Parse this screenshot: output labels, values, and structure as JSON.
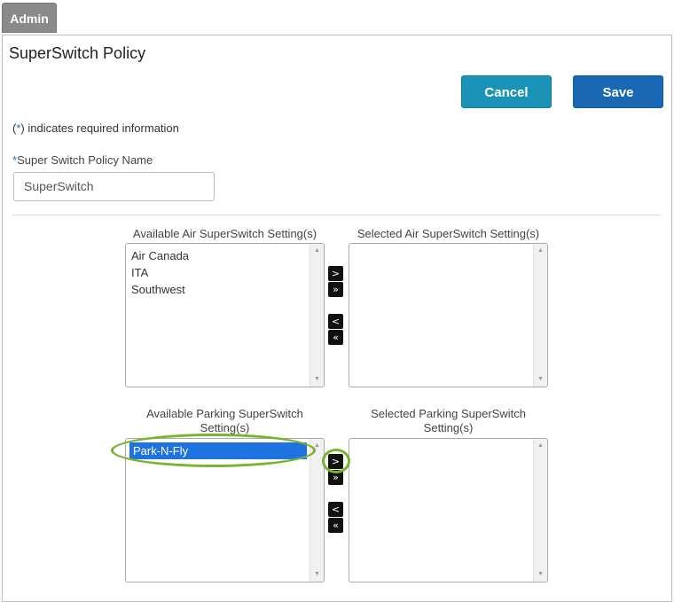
{
  "tab": {
    "label": "Admin"
  },
  "page": {
    "title": "SuperSwitch Policy"
  },
  "actions": {
    "cancel": "Cancel",
    "save": "Save"
  },
  "required_note": {
    "open": "(",
    "star": "*",
    "text": ") indicates required information"
  },
  "policy_name": {
    "star": "*",
    "label": "Super Switch Policy Name",
    "value": "SuperSwitch"
  },
  "air": {
    "available_label": "Available Air SuperSwitch Setting(s)",
    "selected_label": "Selected Air SuperSwitch Setting(s)",
    "available_items": [
      "Air Canada",
      "ITA",
      "Southwest"
    ],
    "selected_items": []
  },
  "parking": {
    "available_label": "Available Parking SuperSwitch Setting(s)",
    "selected_label": "Selected Parking SuperSwitch Setting(s)",
    "available_items": [
      "Park-N-Fly"
    ],
    "selected_items": []
  },
  "move_buttons": {
    "move_right": ">",
    "move_all_right": "»",
    "move_left": "<",
    "move_all_left": "«"
  },
  "icons": [
    "scroll-up-icon",
    "scroll-down-icon"
  ],
  "colors": {
    "cancel": "#1a93b6",
    "save": "#1968b4",
    "highlight": "#7ab32e",
    "selected_item": "#1e73e0"
  }
}
